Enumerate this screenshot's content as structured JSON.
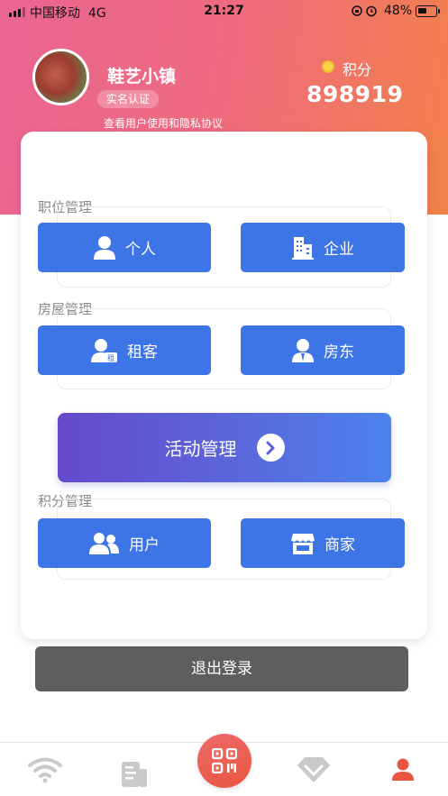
{
  "status_bar": {
    "carrier": "中国移动",
    "network": "4G",
    "time": "21:27",
    "battery": "48%"
  },
  "profile": {
    "username": "鞋艺小镇",
    "verify_badge": "实名认证",
    "privacy_link": "查看用户使用和隐私协议",
    "points_label": "积分",
    "points_value": "898919"
  },
  "sections": {
    "position": {
      "title": "职位管理",
      "left_label": "个人",
      "left_icon": "person-icon",
      "right_label": "企业",
      "right_icon": "building-icon"
    },
    "housing": {
      "title": "房屋管理",
      "left_label": "租客",
      "left_icon": "tenant-icon",
      "right_label": "房东",
      "right_icon": "landlord-icon"
    },
    "activity": {
      "label": "活动管理",
      "icon": "chevron-right-circle-icon"
    },
    "points": {
      "title": "积分管理",
      "left_label": "用户",
      "left_icon": "users-icon",
      "right_label": "商家",
      "right_icon": "shop-icon"
    }
  },
  "logout_label": "退出登录",
  "tabbar": {
    "tabs": [
      "wifi-icon",
      "news-icon",
      "qr-scan-icon",
      "diamond-icon",
      "profile-icon"
    ],
    "active": "profile-icon",
    "accent": "#e9563f"
  },
  "colors": {
    "header_gradient_start": "#ea6593",
    "header_gradient_end": "#f28149",
    "button_blue": "#3d74e6",
    "activity_gradient_start": "#6549cc",
    "activity_gradient_end": "#4c82ec",
    "logout_gray": "#5e5e5e"
  }
}
